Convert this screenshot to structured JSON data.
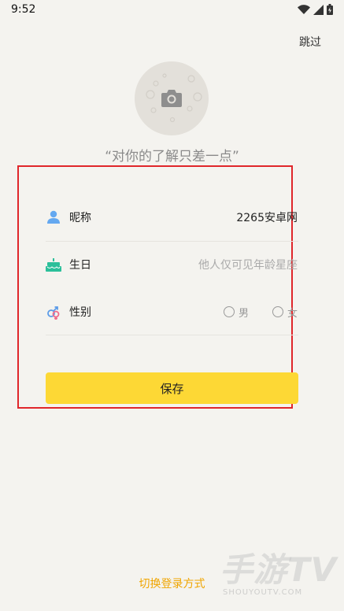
{
  "status_bar": {
    "time": "9:52"
  },
  "header": {
    "skip_label": "跳过"
  },
  "tagline": "“对你的了解只差一点”",
  "form": {
    "nickname": {
      "label": "昵称",
      "value": "2265安卓网"
    },
    "birthday": {
      "label": "生日",
      "placeholder": "他人仅可见年龄星座"
    },
    "gender": {
      "label": "性别",
      "options": [
        "男",
        "女"
      ]
    }
  },
  "save_label": "保存",
  "switch_login_label": "切换登录方式",
  "watermark": {
    "main": "手游TV",
    "sub": "SHOUYOUTV.COM"
  },
  "colors": {
    "accent": "#fdd835",
    "link": "#f0a500",
    "highlight": "#e0262b",
    "background": "#f4f3ef"
  },
  "icons": [
    "wifi-icon",
    "signal-icon",
    "battery-icon",
    "camera-icon",
    "user-icon",
    "cake-icon",
    "gender-icon"
  ]
}
